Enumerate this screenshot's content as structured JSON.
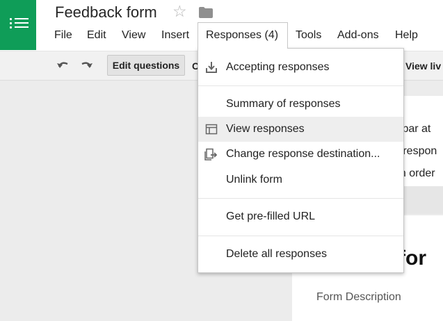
{
  "header": {
    "doc_title": "Feedback form",
    "menu": [
      "File",
      "Edit",
      "View",
      "Insert",
      "Responses (4)",
      "Tools",
      "Add-ons",
      "Help"
    ]
  },
  "toolbar": {
    "edit_questions": "Edit questions",
    "partial_button": "C",
    "view_live": "View liv"
  },
  "responses_menu": {
    "items": [
      "Accepting responses",
      "Summary of responses",
      "View responses",
      "Change response destination...",
      "Unlink form",
      "Get pre-filled URL",
      "Delete all responses"
    ],
    "highlighted_index": 2
  },
  "form_preview": {
    "partial_lines": [
      "s bar at",
      "e respon",
      "on order"
    ],
    "title_partial": "k for",
    "description_placeholder": "Form Description"
  },
  "colors": {
    "brand": "#0f9d58",
    "menu_hover": "#eeeeee"
  },
  "icons": [
    "forms-logo-icon",
    "star-icon",
    "folder-icon",
    "undo-icon",
    "redo-icon",
    "download-tray-icon",
    "table-icon",
    "move-output-icon"
  ]
}
